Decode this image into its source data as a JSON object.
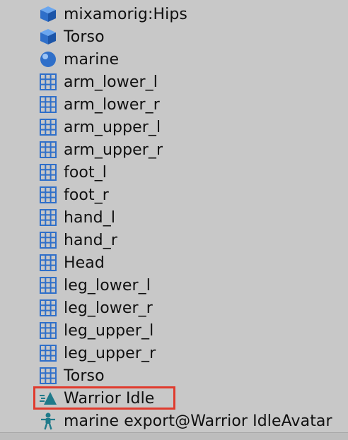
{
  "hierarchy": {
    "clipped_top_label": "mixamorig:Hips",
    "items": [
      {
        "label": "mixamorig:Hips",
        "icon": "prefab-icon"
      },
      {
        "label": "Torso",
        "icon": "prefab-icon"
      },
      {
        "label": "marine",
        "icon": "material-icon"
      },
      {
        "label": "arm_lower_l",
        "icon": "mesh-grid-icon"
      },
      {
        "label": "arm_lower_r",
        "icon": "mesh-grid-icon"
      },
      {
        "label": "arm_upper_l",
        "icon": "mesh-grid-icon"
      },
      {
        "label": "arm_upper_r",
        "icon": "mesh-grid-icon"
      },
      {
        "label": "foot_l",
        "icon": "mesh-grid-icon"
      },
      {
        "label": "foot_r",
        "icon": "mesh-grid-icon"
      },
      {
        "label": "hand_l",
        "icon": "mesh-grid-icon"
      },
      {
        "label": "hand_r",
        "icon": "mesh-grid-icon"
      },
      {
        "label": "Head",
        "icon": "mesh-grid-icon"
      },
      {
        "label": "leg_lower_l",
        "icon": "mesh-grid-icon"
      },
      {
        "label": "leg_lower_r",
        "icon": "mesh-grid-icon"
      },
      {
        "label": "leg_upper_l",
        "icon": "mesh-grid-icon"
      },
      {
        "label": "leg_upper_r",
        "icon": "mesh-grid-icon"
      },
      {
        "label": "Torso",
        "icon": "mesh-grid-icon"
      },
      {
        "label": "Warrior Idle",
        "icon": "animation-clip-icon"
      },
      {
        "label": "marine export@Warrior IdleAvatar",
        "icon": "avatar-icon"
      }
    ]
  },
  "colors": {
    "background": "#c8c8c8",
    "icon_blue": "#2f6fc9",
    "icon_teal": "#1f7a8a",
    "highlight_red": "#e03b2e",
    "text": "#101010"
  }
}
